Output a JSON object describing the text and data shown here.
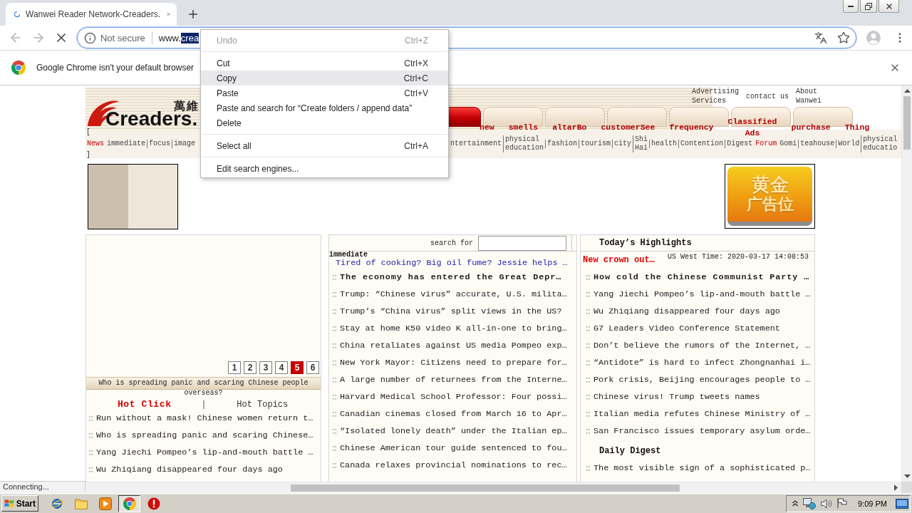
{
  "browser": {
    "tab": {
      "title": "Wanwei Reader Network-Creaders.",
      "loading": true
    },
    "omnibox": {
      "security": "Not secure",
      "url": "www.",
      "url_selected": "crea"
    },
    "infobar": {
      "message": "Google Chrome isn't your default browser"
    },
    "status": "Connecting..."
  },
  "context_menu": [
    {
      "kind": "item",
      "label": "Undo",
      "shortcut": "Ctrl+Z",
      "disabled": true,
      "selected": false
    },
    {
      "kind": "separator"
    },
    {
      "kind": "item",
      "label": "Cut",
      "shortcut": "Ctrl+X",
      "disabled": false,
      "selected": false
    },
    {
      "kind": "item",
      "label": "Copy",
      "shortcut": "Ctrl+C",
      "disabled": false,
      "selected": true
    },
    {
      "kind": "item",
      "label": "Paste",
      "shortcut": "Ctrl+V",
      "disabled": false,
      "selected": false
    },
    {
      "kind": "item",
      "label": "Paste and search for “Create folders / append data”",
      "disabled": false,
      "selected": false
    },
    {
      "kind": "item",
      "label": "Delete",
      "disabled": false,
      "selected": false
    },
    {
      "kind": "separator"
    },
    {
      "kind": "item",
      "label": "Select all",
      "shortcut": "Ctrl+A",
      "disabled": false,
      "selected": false
    },
    {
      "kind": "separator"
    },
    {
      "kind": "item",
      "label": "Edit search engines...",
      "disabled": false,
      "selected": false
    }
  ],
  "site": {
    "logo": {
      "text": "Creaders.",
      "chinese": "萬維"
    },
    "top_links": [
      "Advertising Services",
      "contact us",
      "About Wanwei"
    ],
    "channel_tabs": [
      {
        "selected": true
      },
      {
        "selected": false
      },
      {
        "selected": false
      },
      {
        "selected": false
      },
      {
        "selected": false
      },
      {
        "selected": false
      },
      {
        "selected": false
      }
    ],
    "channel_labels": [
      "new",
      "smells",
      "altarBo",
      "customerSee",
      "frequency",
      "Classified Ads",
      "purchase",
      "Thing"
    ],
    "nav_brackets": [
      "[",
      "]"
    ],
    "nav_left": [
      {
        "label": "News",
        "highlight": true
      },
      {
        "label": "immediate",
        "highlight": false
      },
      {
        "label": "focus",
        "highlight": false
      },
      {
        "label": "image",
        "highlight": false
      }
    ],
    "nav_right": [
      {
        "label": "ntertainment",
        "highlight": false
      },
      {
        "label": "physical education",
        "highlight": false
      },
      {
        "label": "fashion",
        "highlight": false
      },
      {
        "label": "tourism",
        "highlight": false
      },
      {
        "label": "city",
        "highlight": false
      },
      {
        "label": "Shi Hai",
        "highlight": false
      },
      {
        "label": "health",
        "highlight": false
      },
      {
        "label": "Contention",
        "highlight": false
      },
      {
        "label": "Digest",
        "highlight": false
      },
      {
        "label": "Forum",
        "highlight": true
      },
      {
        "label": "Gomi",
        "highlight": false
      },
      {
        "label": "teahouse",
        "highlight": false
      },
      {
        "label": "World",
        "highlight": false
      },
      {
        "label": "physical educatio",
        "highlight": false
      }
    ],
    "gold_ad": {
      "lines": [
        "黄金",
        "广告位"
      ]
    },
    "slideshow": {
      "pages": [
        {
          "label": "1",
          "selected": false
        },
        {
          "label": "2",
          "selected": false
        },
        {
          "label": "3",
          "selected": false
        },
        {
          "label": "4",
          "selected": false
        },
        {
          "label": "5",
          "selected": true
        },
        {
          "label": "6",
          "selected": false
        }
      ],
      "caption": "Who is spreading panic and scaring Chinese people overseas?"
    },
    "hot_tabs": [
      {
        "label": "Hot Click",
        "selected": true
      },
      {
        "label": "Hot Topics",
        "selected": false
      }
    ],
    "hot_items": [
      {
        "text": "Run without a mask! Chinese women return t…",
        "bold": false
      },
      {
        "text": "Who is spreading panic and scaring Chinese…",
        "bold": false
      },
      {
        "text": "Yang Jiechi Pompeo’s lip-and-mouth battle …",
        "bold": false
      },
      {
        "text": "Wu Zhiqiang disappeared four days ago",
        "bold": false
      }
    ],
    "search": {
      "label": "search for"
    },
    "immediate": {
      "label": "immediate",
      "promo": "Tired of cooking? Big oil fume? Jessie helps …"
    },
    "news_items": [
      {
        "text": "The economy has entered the Great Depr…",
        "bold": true
      },
      {
        "text": "Trump: “Chinese virus” accurate, U.S. milita…",
        "bold": false
      },
      {
        "text": "Trump’s “China virus” split views in the US?",
        "bold": false
      },
      {
        "text": "Stay at home K50 video K all-in-one to bring…",
        "bold": false
      },
      {
        "text": "China retaliates against US media Pompeo exp…",
        "bold": false
      },
      {
        "text": "New York Mayor: Citizens need to prepare for…",
        "bold": false
      },
      {
        "text": "A large number of returnees from the Interne…",
        "bold": false
      },
      {
        "text": "Harvard Medical School Professor: Four possi…",
        "bold": false
      },
      {
        "text": "Canadian cinemas closed from March 16 to Apr…",
        "bold": false
      },
      {
        "text": "“Isolated lonely death” under the Italian ep…",
        "bold": false
      },
      {
        "text": "Chinese American tour guide sentenced to fou…",
        "bold": false
      },
      {
        "text": "Canada relaxes provincial nominations to rec…",
        "bold": false
      }
    ],
    "highlights": {
      "title": "Today’s Highlights",
      "breaking": "New crown out…",
      "time": "US West Time: 2020-03-17 14:08:53",
      "items": [
        {
          "text": "How cold the Chinese Communist Party …",
          "bold": true
        },
        {
          "text": "Yang Jiechi Pompeo’s lip-and-mouth battle …",
          "bold": false
        },
        {
          "text": "Wu Zhiqiang disappeared four days ago",
          "bold": false
        },
        {
          "text": "G7 Leaders Video Conference Statement",
          "bold": false
        },
        {
          "text": "Don’t believe the rumors of the Internet, …",
          "bold": false
        },
        {
          "text": "“Antidote” is hard to infect Zhongnanhai i…",
          "bold": false
        },
        {
          "text": "Pork crisis, Beijing encourages people to …",
          "bold": false
        },
        {
          "text": "Chinese virus! Trump tweets names",
          "bold": false
        },
        {
          "text": "Italian media refutes Chinese Ministry of …",
          "bold": false
        },
        {
          "text": "San Francisco issues temporary asylum orde…",
          "bold": false
        }
      ]
    },
    "digest": {
      "title": "Daily Digest",
      "items": [
        {
          "text": "The most visible sign of a sophisticated p…",
          "bold": false
        }
      ]
    }
  },
  "taskbar": {
    "start": "Start",
    "apps": [
      {
        "kind": "ie",
        "active": false
      },
      {
        "kind": "folder",
        "active": false
      },
      {
        "kind": "media",
        "active": false
      },
      {
        "kind": "chrome",
        "active": true
      },
      {
        "kind": "alert",
        "active": false
      }
    ],
    "clock": "9:09 PM"
  }
}
